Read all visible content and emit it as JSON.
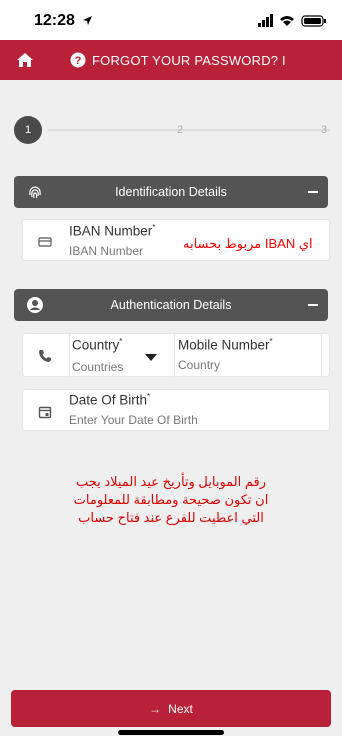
{
  "status_bar": {
    "time": "12:28"
  },
  "header": {
    "title": "FORGOT YOUR PASSWORD? I"
  },
  "stepper": {
    "steps": [
      "1",
      "2",
      "3"
    ]
  },
  "sections": {
    "identification": {
      "title": "Identification Details"
    },
    "authentication": {
      "title": "Authentication Details"
    }
  },
  "fields": {
    "iban": {
      "label": "IBAN Number",
      "required": "*",
      "placeholder": "IBAN Number"
    },
    "country": {
      "label": "Country",
      "required": "*",
      "placeholder": "Countries"
    },
    "mobile": {
      "label": "Mobile Number",
      "required": "*",
      "placeholder": "Country"
    },
    "dob": {
      "label": "Date Of Birth",
      "required": "*",
      "placeholder": "Enter Your Date Of Birth"
    }
  },
  "annotations": {
    "iban_note": "اي IBAN مربوط بحسابه",
    "main_note": [
      "رقم الموبايل وتأريخ عيد الميلاد يجب",
      "ان تكون صحيحة ومطابقة للمعلومات",
      "التي اعطيت للفرع عند فتاح حساب"
    ]
  },
  "footer": {
    "next_label": "Next"
  },
  "colors": {
    "brand": "#b82137",
    "section_bg": "#545454",
    "note": "#ff0000"
  }
}
